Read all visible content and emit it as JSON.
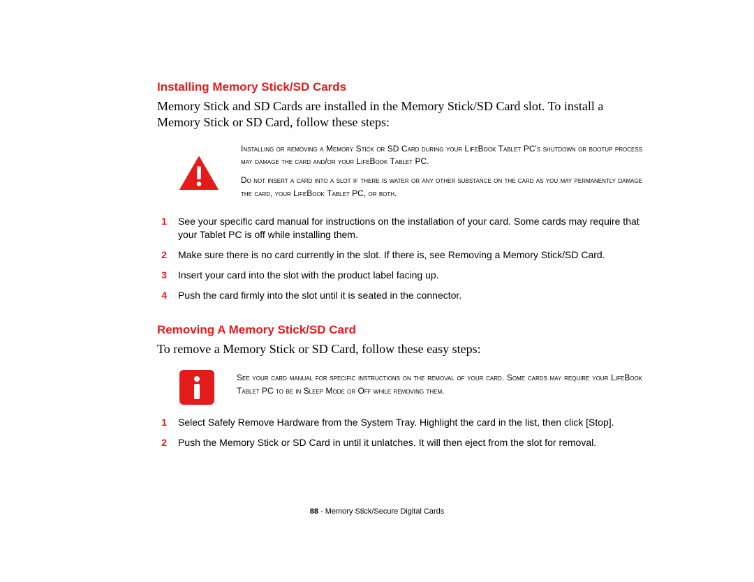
{
  "section1": {
    "heading": "Installing Memory Stick/SD Cards",
    "intro": "Memory Stick and SD Cards are installed in the Memory Stick/SD Card slot. To install a Memory Stick or SD Card, follow these steps:",
    "warning_p1": "Installing or removing a Memory Stick or SD Card during your LifeBook Tablet PC's shutdown or bootup process may damage the card and/or your LifeBook Tablet PC.",
    "warning_p2": "Do not insert a card into a slot if there is water or any other substance on the card as you may permanently damage the card, your LifeBook Tablet PC, or both.",
    "steps": [
      "See your specific card manual for instructions on the installation of your card. Some cards may require that your Tablet PC is off while installing them.",
      "Make sure there is no card currently in the slot. If there is, see Removing a Memory Stick/SD Card.",
      "Insert your card into the slot with the product label facing up.",
      "Push the card firmly into the slot until it is seated in the connector."
    ]
  },
  "section2": {
    "heading": "Removing A Memory Stick/SD Card",
    "intro": "To remove a Memory Stick or SD Card, follow these easy steps:",
    "info_p1": "See your card manual for specific instructions on the removal of your card. Some cards may require your LifeBook Tablet PC to be in Sleep Mode or Off while removing them.",
    "steps": [
      "Select Safely Remove Hardware from the System Tray. Highlight the card in the list, then click [Stop].",
      "Push the Memory Stick or SD Card in until it unlatches. It will then eject from the slot for removal."
    ]
  },
  "footer": {
    "page_num": "88",
    "sep": " - ",
    "title": "Memory Stick/Secure Digital Cards"
  },
  "numbers": [
    "1",
    "2",
    "3",
    "4"
  ]
}
